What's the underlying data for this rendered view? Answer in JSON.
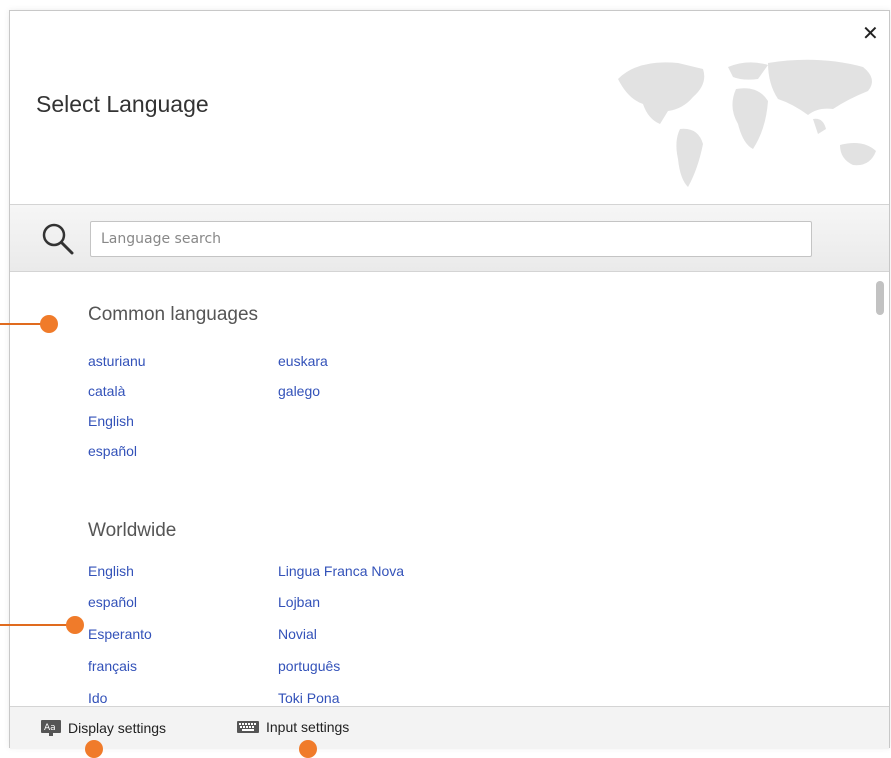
{
  "dialog": {
    "title": "Select Language",
    "close_label": "✕"
  },
  "search": {
    "placeholder": "Language search"
  },
  "sections": {
    "common": {
      "title": "Common languages",
      "languages": [
        "asturianu",
        "català",
        "English",
        "español",
        "euskara",
        "galego"
      ]
    },
    "worldwide": {
      "title": "Worldwide",
      "languages": [
        "English",
        "español",
        "Esperanto",
        "français",
        "Ido",
        "Lingua Franca Nova",
        "Lojban",
        "Novial",
        "português",
        "Toki Pona"
      ]
    }
  },
  "footer": {
    "display_settings": "Display settings",
    "input_settings": "Input settings"
  },
  "icons": {
    "close": "close-icon",
    "search": "search-icon",
    "display": "display-settings-icon",
    "input": "keyboard-icon",
    "map": "world-map-icon"
  },
  "colors": {
    "link": "#3352b9",
    "callout": "#f07b2a"
  }
}
